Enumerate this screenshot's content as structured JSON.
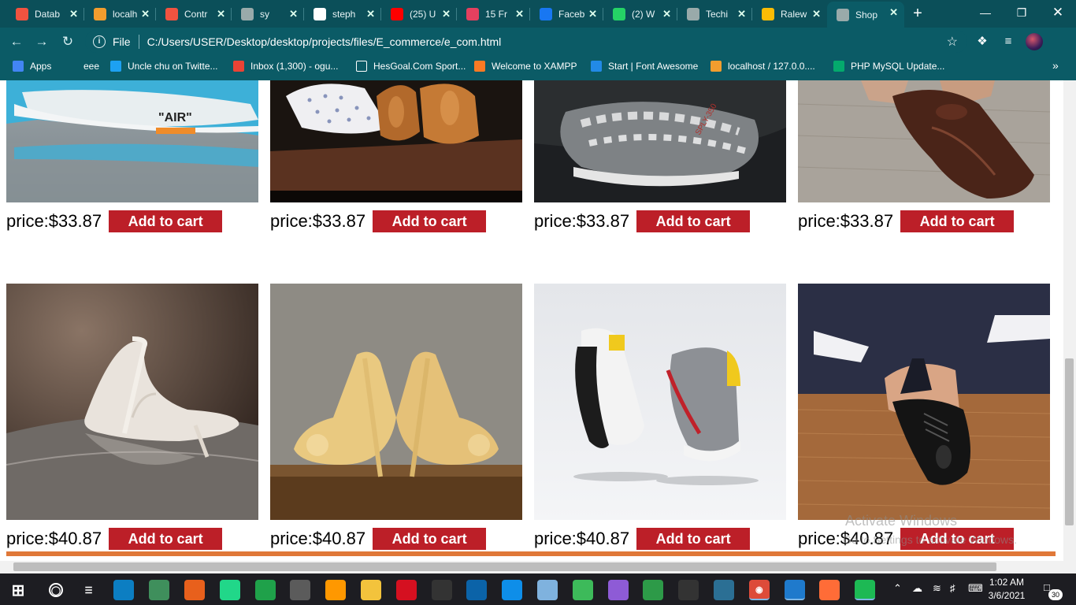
{
  "browser": {
    "tabs": [
      {
        "label": "Datab",
        "icon": "laravel-icon",
        "color": "#f05340"
      },
      {
        "label": "localh",
        "icon": "phpmyadmin-icon",
        "color": "#f29d2e"
      },
      {
        "label": "Contr",
        "icon": "laravel-icon",
        "color": "#f05340"
      },
      {
        "label": "sy",
        "icon": "globe-icon",
        "color": "#9aa"
      },
      {
        "label": "steph",
        "icon": "github-icon",
        "color": "#ffffff"
      },
      {
        "label": "(25) U",
        "icon": "youtube-icon",
        "color": "#ff0000"
      },
      {
        "label": "15 Fr",
        "icon": "rocket-icon",
        "color": "#e4405f"
      },
      {
        "label": "Faceb",
        "icon": "facebook-icon",
        "color": "#1877f2"
      },
      {
        "label": "(2) W",
        "icon": "whatsapp-icon",
        "color": "#25d366"
      },
      {
        "label": "Techi",
        "icon": "globe-icon",
        "color": "#9aa"
      },
      {
        "label": "Ralew",
        "icon": "fonts-icon",
        "color": "#fbbc05"
      },
      {
        "label": "Shop",
        "icon": "globe-icon",
        "color": "#9aa"
      }
    ],
    "active_tab": 11,
    "new_tab": "+",
    "address": {
      "scheme": "File",
      "url": "C:/Users/USER/Desktop/desktop/projects/files/E_commerce/e_com.html"
    },
    "bookmarks": [
      {
        "label": "Apps",
        "icon": "apps-grid-icon"
      },
      {
        "label": "eee",
        "icon": "bookmark-icon"
      },
      {
        "label": "Uncle chu on Twitte...",
        "icon": "twitter-icon"
      },
      {
        "label": "Inbox (1,300) - ogu...",
        "icon": "gmail-icon"
      },
      {
        "label": "HesGoal.Com Sport...",
        "icon": "sport-icon"
      },
      {
        "label": "Welcome to XAMPP",
        "icon": "xampp-icon"
      },
      {
        "label": "Start | Font Awesome",
        "icon": "flag-icon"
      },
      {
        "label": "localhost / 127.0.0....",
        "icon": "phpmyadmin-icon"
      },
      {
        "label": "PHP MySQL Update...",
        "icon": "w3-icon"
      }
    ]
  },
  "products": [
    {
      "price": "price:$33.87",
      "button": "Add to cart",
      "image": "off-white-air-sneaker"
    },
    {
      "price": "price:$33.87",
      "button": "Add to cart",
      "image": "brown-leather-shoes"
    },
    {
      "price": "price:$33.87",
      "button": "Add to cart",
      "image": "yeezy-350-sneaker"
    },
    {
      "price": "price:$33.87",
      "button": "Add to cart",
      "image": "brown-oxford-shoe"
    },
    {
      "price": "price:$40.87",
      "button": "Add to cart",
      "image": "white-heels"
    },
    {
      "price": "price:$40.87",
      "button": "Add to cart",
      "image": "yellow-heels"
    },
    {
      "price": "price:$40.87",
      "button": "Add to cart",
      "image": "running-sneakers"
    },
    {
      "price": "price:$40.87",
      "button": "Add to cart",
      "image": "black-dress-shoe"
    }
  ],
  "sneaker_text": "\"AIR\"",
  "yeezy_text": "SPLY-350",
  "watermark": {
    "title": "Activate Windows",
    "subtitle": "Go to Settings to activate Windows."
  },
  "taskbar": {
    "apps": [
      "start-icon",
      "cortana-icon",
      "taskview-icon",
      "edge-icon",
      "electron-icon",
      "firefox-icon",
      "pycharm-icon",
      "circle-app-icon",
      "obs-icon",
      "sublime-icon",
      "file-explorer-icon",
      "opera-icon",
      "terminal-icon",
      "store-icon",
      "teamviewer-icon",
      "virtualbox-icon",
      "android-studio-icon",
      "github-desktop-icon",
      "git-icon",
      "hs-icon",
      "mysql-workbench-icon",
      "chrome-icon",
      "vscode-icon",
      "postman-icon",
      "spotify-icon"
    ],
    "time": "1:02 AM",
    "date": "3/6/2021",
    "notification_count": "30"
  },
  "colors": {
    "chrome_bg": "#0b5b66",
    "cart_button": "#bc1f28",
    "footer_bar": "#e07838"
  }
}
